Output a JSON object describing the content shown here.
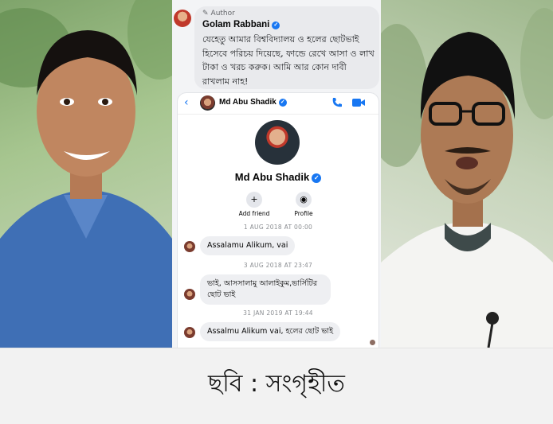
{
  "comment": {
    "author_tag": "Author",
    "author_name": "Golam Rabbani",
    "text": "যেহেতু আমার বিশ্ববিদ্যালয় ও হলের ছোটভাই হিসেবে পরিচয় দিয়েছে, ফান্ডে রেখে আসা ও লাখ টাকা ও খরচ করুক। আমি আর কোন দাবী রাখলাম নাহ!"
  },
  "messenger": {
    "header_name": "Md Abu Shadik",
    "profile_name": "Md Abu Shadik",
    "actions": [
      {
        "label": "Add friend",
        "icon": "add-friend-icon"
      },
      {
        "label": "Profile",
        "icon": "profile-icon"
      }
    ],
    "thread": [
      {
        "date": "1 AUG 2018 AT 00:00",
        "message": "Assalamu Alikum, vai"
      },
      {
        "date": "3 AUG 2018 AT 23:47",
        "message": "ভাই, আসসালামু আলাইকুম,ভার্সিটির ছোট ভাই"
      },
      {
        "date": "31 JAN 2019 AT 19:44",
        "message": "Assalmu Alikum vai, হলের ছোট ভাই"
      }
    ]
  },
  "caption": "ছবি : সংগৃহীত",
  "colors": {
    "accent": "#1877f2",
    "bubble": "#e9eaed",
    "caption_bg": "#f2f2f2"
  }
}
